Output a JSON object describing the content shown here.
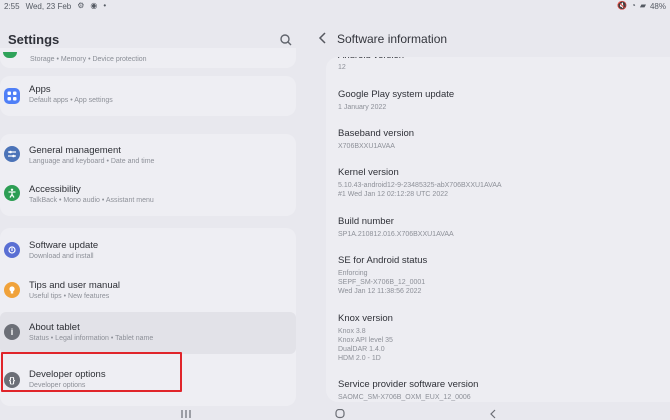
{
  "status": {
    "time": "2:55",
    "date": "Wed, 23 Feb",
    "battery": "48%"
  },
  "left": {
    "title": "Settings",
    "top_partial_subtitle": "Storage  •  Memory  •  Device protection",
    "groups": [
      {
        "items": [
          {
            "title": "Apps",
            "subtitle": "Default apps  •  App settings",
            "icon": "apps-icon",
            "color": "#4f7ff7"
          }
        ]
      },
      {
        "items": [
          {
            "title": "General management",
            "subtitle": "Language and keyboard  •  Date and time",
            "icon": "sliders-icon",
            "color": "#4b73b8"
          },
          {
            "title": "Accessibility",
            "subtitle": "TalkBack  •  Mono audio  •  Assistant menu",
            "icon": "accessibility-icon",
            "color": "#2d9e54"
          }
        ]
      },
      {
        "items": [
          {
            "title": "Software update",
            "subtitle": "Download and install",
            "icon": "software-update-icon",
            "color": "#5a6fd3"
          },
          {
            "title": "Tips and user manual",
            "subtitle": "Useful tips  •  New features",
            "icon": "lightbulb-icon",
            "color": "#f0a23a"
          },
          {
            "title": "About tablet",
            "subtitle": "Status  •  Legal information  •  Tablet name",
            "icon": "info-icon",
            "color": "#6c6f77"
          },
          {
            "title": "Developer options",
            "subtitle": "Developer options",
            "icon": "developer-options-icon",
            "color": "#6c6f77"
          }
        ]
      }
    ]
  },
  "right": {
    "title": "Software information",
    "rows": [
      {
        "key": "Android version",
        "value": "12"
      },
      {
        "key": "Google Play system update",
        "value": "1 January 2022"
      },
      {
        "key": "Baseband version",
        "value": "X706BXXU1AVAA"
      },
      {
        "key": "Kernel version",
        "value": "5.10.43-android12-9-23485325-abX706BXXU1AVAA\n#1 Wed Jan 12 02:12:28 UTC 2022"
      },
      {
        "key": "Build number",
        "value": "SP1A.210812.016.X706BXXU1AVAA"
      },
      {
        "key": "SE for Android status",
        "value": "Enforcing\nSEPF_SM-X706B_12_0001\nWed Jan 12 11:38:56 2022"
      },
      {
        "key": "Knox version",
        "value": "Knox 3.8\nKnox API level 35\nDualDAR 1.4.0\nHDM 2.0 - 1D"
      },
      {
        "key": "Service provider software version",
        "value": "SAOMC_SM-X706B_OXM_EUX_12_0006"
      }
    ]
  }
}
